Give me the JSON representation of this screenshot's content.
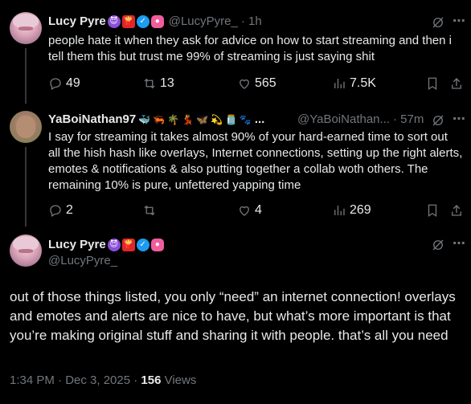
{
  "tweet1": {
    "display_name": "Lucy Pyre",
    "handle": "@LucyPyre_",
    "time": "· 1h",
    "text": "people hate it when they ask for advice on how to start streaming and then i tell them this but trust me 99% of streaming is just saying shit",
    "replies": "49",
    "reposts": "13",
    "likes": "565",
    "views": "7.5K"
  },
  "tweet2": {
    "display_name": "YaBoiNathan97",
    "handle": "@YaBoiNathan...",
    "time": "· 57m",
    "text": "I say for streaming it takes almost 90% of your hard-earned time to sort out all the hish hash like overlays, Internet connections, setting up the right alerts, emotes & notifications & also putting together a collab woth others. The remaining 10% is pure, unfettered yapping time",
    "replies": "2",
    "reposts": "",
    "likes": "4",
    "views": "269"
  },
  "main_tweet": {
    "display_name": "Lucy Pyre",
    "handle": "@LucyPyre_",
    "text": "out of those things listed, you only “need” an internet connection! overlays and emotes and alerts are nice to have, but what’s more important is that you’re making original stuff and sharing it with people. that’s all you need",
    "timestamp": "1:34 PM · Dec 3, 2025 · ",
    "view_count": "156",
    "views_label": " Views"
  },
  "icons": {
    "reply": "reply-icon",
    "repost": "repost-icon",
    "like": "heart-icon",
    "views": "analytics-icon",
    "bookmark": "bookmark-icon",
    "share": "share-icon",
    "grok": "grok-icon",
    "more": "more-icon"
  },
  "colors": {
    "background": "#000000",
    "text": "#e7e9ea",
    "secondary": "#71767b",
    "verified": "#1d9bf0"
  }
}
